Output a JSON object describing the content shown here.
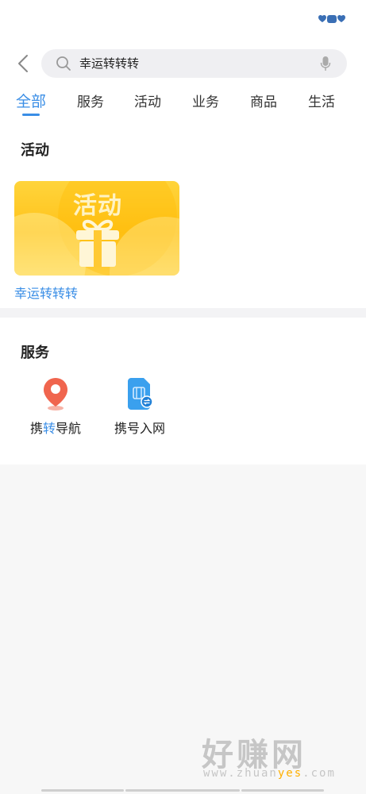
{
  "search": {
    "query": "幸运转转转"
  },
  "tabs": [
    {
      "label": "全部"
    },
    {
      "label": "服务"
    },
    {
      "label": "活动"
    },
    {
      "label": "业务"
    },
    {
      "label": "商品"
    },
    {
      "label": "生活"
    }
  ],
  "activity_section": {
    "title": "活动",
    "banner_text": "活动",
    "item_label": "幸运转转转"
  },
  "service_section": {
    "title": "服务",
    "items": [
      {
        "label_prefix": "携",
        "label_highlight": "转",
        "label_suffix": "导航",
        "icon": "location-pin-icon"
      },
      {
        "label": "携号入网",
        "icon": "sim-card-transfer-icon"
      }
    ]
  },
  "watermark": {
    "main": "好赚网",
    "sub_pre": "www.zhuan",
    "sub_yes": "yes",
    "sub_post": ".com"
  },
  "colors": {
    "accent": "#3a8ee6",
    "banner": "#ffc21a",
    "pin": "#f0654e"
  }
}
